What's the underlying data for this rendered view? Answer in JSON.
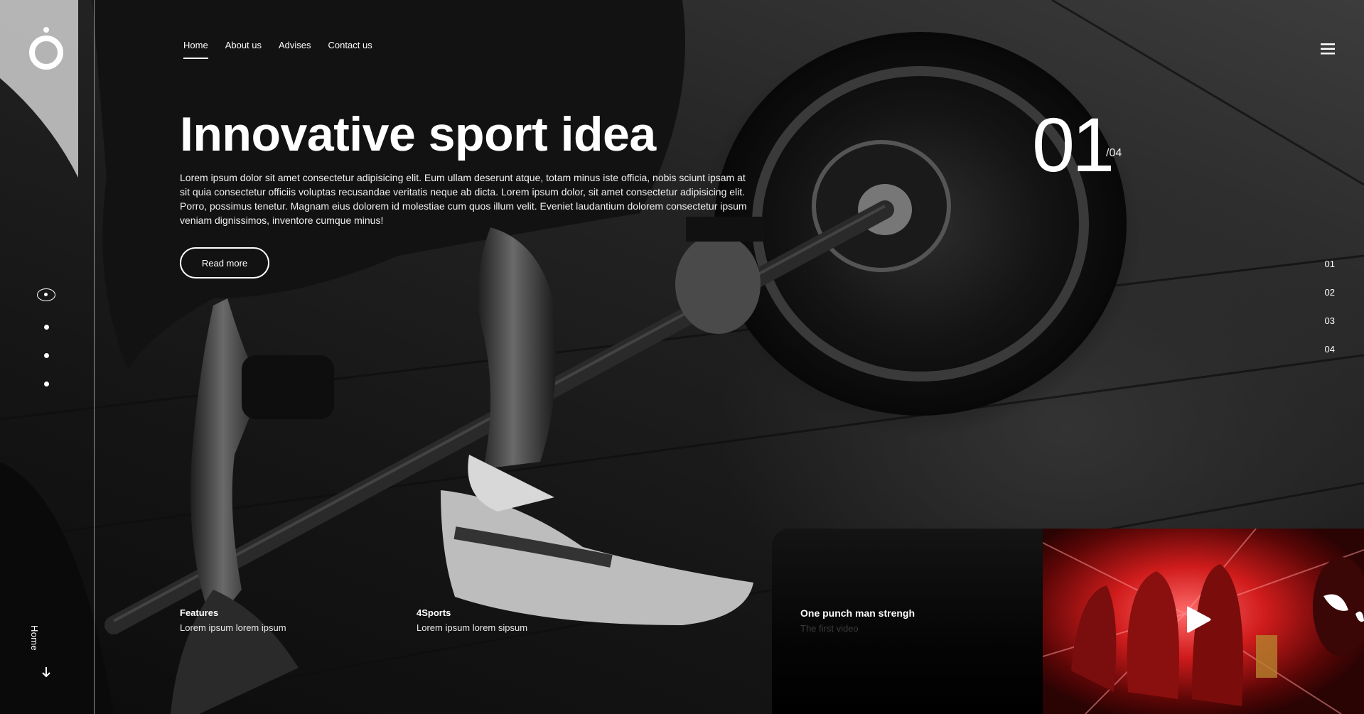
{
  "nav": {
    "items": [
      {
        "label": "Home",
        "active": true
      },
      {
        "label": "About us",
        "active": false
      },
      {
        "label": "Advises",
        "active": false
      },
      {
        "label": "Contact us",
        "active": false
      }
    ],
    "menu_icon": "hamburger-menu-icon"
  },
  "rail": {
    "logo_icon": "brand-logo-icon",
    "section_label": "Home",
    "down_icon": "arrow-down-icon",
    "dots_count": 4,
    "active_dot": 1
  },
  "hero": {
    "title": "Innovative sport idea",
    "body": "Lorem ipsum dolor sit amet consectetur adipisicing elit. Eum ullam deserunt atque, totam minus iste officia, nobis sciunt ipsam at sit quia consectetur officiis voluptas recusandae veritatis neque ab dicta. Lorem ipsum dolor, sit amet consectetur adipisicing elit. Porro, possimus tenetur. Magnam eius dolorem id molestiae cum quos illum velit. Eveniet laudantium dolorem consectetur ipsum veniam dignissimos, inventore cumque minus!",
    "cta_label": "Read more"
  },
  "slider": {
    "current": "01",
    "total": "/04",
    "items": [
      "01",
      "02",
      "03",
      "04"
    ]
  },
  "info": [
    {
      "title": "Features",
      "subtitle": "Lorem ipsum lorem ipsum"
    },
    {
      "title": "4Sports",
      "subtitle": "Lorem ipsum lorem sipsum"
    }
  ],
  "video": {
    "title": "One punch man strengh",
    "subtitle": "The first video",
    "play_icon": "play-icon"
  },
  "colors": {
    "text": "#ffffff",
    "background": "#0b0b0b",
    "video_accent": "#c01818"
  }
}
